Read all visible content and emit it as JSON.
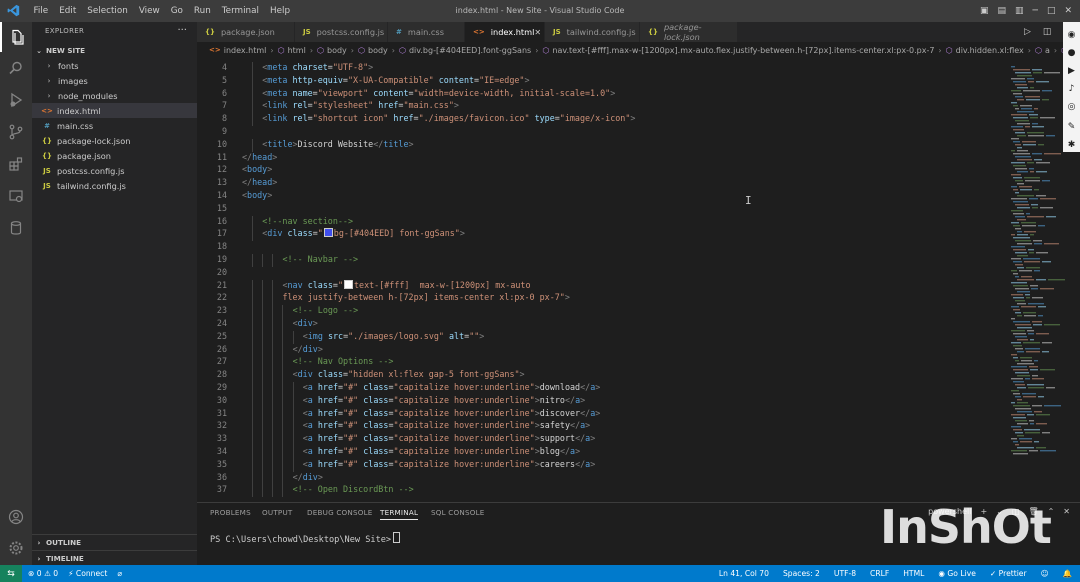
{
  "window": {
    "title": "index.html - New Site - Visual Studio Code",
    "menu": [
      "File",
      "Edit",
      "Selection",
      "View",
      "Go",
      "Run",
      "Terminal",
      "Help"
    ]
  },
  "colors": {
    "accent": "#007acc",
    "remote": "#16825d",
    "tag": "#569cd6",
    "attr": "#9cdcfe",
    "string": "#ce9178",
    "comment": "#6a9955"
  },
  "activity_icons": [
    "files-icon",
    "search-icon",
    "run-debug-icon",
    "source-control-icon",
    "extensions-icon",
    "remote-explorer-icon",
    "database-icon",
    "account-icon",
    "settings-gear-icon"
  ],
  "sidebar": {
    "header": "EXPLORER",
    "folder": "NEW SITE",
    "items": [
      {
        "label": "fonts",
        "type": "folder",
        "icon": "›"
      },
      {
        "label": "images",
        "type": "folder",
        "icon": "›"
      },
      {
        "label": "node_modules",
        "type": "folder",
        "icon": "›"
      },
      {
        "label": "index.html",
        "type": "html",
        "icon": "<>"
      },
      {
        "label": "main.css",
        "type": "css",
        "icon": "#"
      },
      {
        "label": "package-lock.json",
        "type": "json",
        "icon": "{}"
      },
      {
        "label": "package.json",
        "type": "json",
        "icon": "{}"
      },
      {
        "label": "postcss.config.js",
        "type": "js",
        "icon": "JS"
      },
      {
        "label": "tailwind.config.js",
        "type": "js",
        "icon": "JS"
      }
    ],
    "outline": "OUTLINE",
    "timeline": "TIMELINE"
  },
  "tabs": [
    {
      "label": "package.json",
      "icon": "{}"
    },
    {
      "label": "postcss.config.js",
      "icon": "JS"
    },
    {
      "label": "main.css",
      "icon": "#"
    },
    {
      "label": "index.html",
      "icon": "<>",
      "active": true
    },
    {
      "label": "tailwind.config.js",
      "icon": "JS"
    },
    {
      "label": "package-lock.json",
      "icon": "{}"
    }
  ],
  "breadcrumb": [
    "index.html",
    "html",
    "body",
    "body",
    "div.bg-[#404EED].font-ggSans",
    "nav.text-[#fff].max-w-[1200px].mx-auto.flex.justify-between.h-[72px].items-center.xl:px-0.px-7",
    "div.hidden.xl:flex",
    "a",
    "bu"
  ],
  "editor": {
    "lines": [
      {
        "n": "4",
        "indent": 2,
        "html": "<span class='pn'>&lt;</span><span class='tg'>meta</span> <span class='at'>charset</span>=<span class='st'>\"UTF-8\"</span><span class='pn'>&gt;</span>"
      },
      {
        "n": "5",
        "indent": 2,
        "html": "<span class='pn'>&lt;</span><span class='tg'>meta</span> <span class='at'>http-equiv</span>=<span class='st'>\"X-UA-Compatible\"</span> <span class='at'>content</span>=<span class='st'>\"IE=edge\"</span><span class='pn'>&gt;</span>"
      },
      {
        "n": "6",
        "indent": 2,
        "html": "<span class='pn'>&lt;</span><span class='tg'>meta</span> <span class='at'>name</span>=<span class='st'>\"viewport\"</span> <span class='at'>content</span>=<span class='st'>\"width=device-width, initial-scale=1.0\"</span><span class='pn'>&gt;</span>"
      },
      {
        "n": "7",
        "indent": 2,
        "html": "<span class='pn'>&lt;</span><span class='tg'>link</span> <span class='at'>rel</span>=<span class='st'>\"stylesheet\"</span> <span class='at'>href</span>=<span class='st'>\"main.css\"</span><span class='pn'>&gt;</span>"
      },
      {
        "n": "8",
        "indent": 2,
        "html": "<span class='pn'>&lt;</span><span class='tg'>link</span> <span class='at'>rel</span>=<span class='st'>\"shortcut icon\"</span> <span class='at'>href</span>=<span class='st'>\"./images/favicon.ico\"</span> <span class='at'>type</span>=<span class='st'>\"image/x-icon\"</span><span class='pn'>&gt;</span>"
      },
      {
        "n": "9",
        "indent": 0,
        "html": ""
      },
      {
        "n": "10",
        "indent": 2,
        "html": "<span class='pn'>&lt;</span><span class='tg'>title</span><span class='pn'>&gt;</span><span class='tx'>Discord Website</span><span class='pn'>&lt;/</span><span class='tg'>title</span><span class='pn'>&gt;</span>"
      },
      {
        "n": "11",
        "indent": 0,
        "html": "<span class='pn'>&lt;/</span><span class='tg'>head</span><span class='pn'>&gt;</span>"
      },
      {
        "n": "12",
        "indent": 0,
        "html": "<span class='pn'>&lt;</span><span class='tg'>body</span><span class='pn'>&gt;</span>"
      },
      {
        "n": "13",
        "indent": 0,
        "html": "<span class='pn'>&lt;/</span><span class='tg'>head</span><span class='pn'>&gt;</span>"
      },
      {
        "n": "14",
        "indent": 0,
        "html": "<span class='pn'>&lt;</span><span class='tg'>body</span><span class='pn'>&gt;</span>"
      },
      {
        "n": "15",
        "indent": 0,
        "html": ""
      },
      {
        "n": "16",
        "indent": 2,
        "html": "<span class='cm'>&lt;!--nav section--&gt;</span>"
      },
      {
        "n": "17",
        "indent": 2,
        "html": "<span class='pn'>&lt;</span><span class='tg'>div</span> <span class='at'>class</span>=<span class='st'>\"<span class='swatch' style='background:#404EED'></span>bg-[#404EED] font-ggSans\"</span><span class='pn'>&gt;</span>"
      },
      {
        "n": "18",
        "indent": 0,
        "html": ""
      },
      {
        "n": "19",
        "indent": 4,
        "html": "<span class='cm'>&lt;!-- Navbar --&gt;</span>"
      },
      {
        "n": "20",
        "indent": 0,
        "html": ""
      },
      {
        "n": "21",
        "indent": 4,
        "html": "<span class='pn'>&lt;</span><span class='tg'>nav</span> <span class='at'>class</span>=<span class='st'>\"<span class='swatch' style='background:#ffffff'></span>text-[#fff]  max-w-[1200px] mx-auto</span>"
      },
      {
        "n": "22",
        "indent": 4,
        "html": "<span class='st'>flex justify-between h-[72px] items-center xl:px-0 px-7\"</span><span class='pn'>&gt;</span>"
      },
      {
        "n": "23",
        "indent": 5,
        "html": "<span class='cm'>&lt;!-- Logo --&gt;</span>"
      },
      {
        "n": "24",
        "indent": 5,
        "html": "<span class='pn'>&lt;</span><span class='tg'>div</span><span class='pn'>&gt;</span>"
      },
      {
        "n": "25",
        "indent": 6,
        "html": "<span class='pn'>&lt;</span><span class='tg'>img</span> <span class='at'>src</span>=<span class='st'>\"./images/logo.svg\"</span> <span class='at'>alt</span>=<span class='st'>\"\"</span><span class='pn'>&gt;</span>"
      },
      {
        "n": "26",
        "indent": 5,
        "html": "<span class='pn'>&lt;/</span><span class='tg'>div</span><span class='pn'>&gt;</span>"
      },
      {
        "n": "27",
        "indent": 5,
        "html": "<span class='cm'>&lt;!-- Nav Options --&gt;</span>"
      },
      {
        "n": "28",
        "indent": 5,
        "html": "<span class='pn'>&lt;</span><span class='tg'>div</span> <span class='at'>class</span>=<span class='st'>\"hidden xl:flex gap-5 font-ggSans\"</span><span class='pn'>&gt;</span>"
      },
      {
        "n": "29",
        "indent": 6,
        "html": "<span class='pn'>&lt;</span><span class='tg'>a</span> <span class='at'>href</span>=<span class='st'>\"#\"</span> <span class='at'>class</span>=<span class='st'>\"capitalize hover:underline\"</span><span class='pn'>&gt;</span><span class='tx'>download</span><span class='pn'>&lt;/</span><span class='tg'>a</span><span class='pn'>&gt;</span>"
      },
      {
        "n": "30",
        "indent": 6,
        "html": "<span class='pn'>&lt;</span><span class='tg'>a</span> <span class='at'>href</span>=<span class='st'>\"#\"</span> <span class='at'>class</span>=<span class='st'>\"capitalize hover:underline\"</span><span class='pn'>&gt;</span><span class='tx'>nitro</span><span class='pn'>&lt;/</span><span class='tg'>a</span><span class='pn'>&gt;</span>"
      },
      {
        "n": "31",
        "indent": 6,
        "html": "<span class='pn'>&lt;</span><span class='tg'>a</span> <span class='at'>href</span>=<span class='st'>\"#\"</span> <span class='at'>class</span>=<span class='st'>\"capitalize hover:underline\"</span><span class='pn'>&gt;</span><span class='tx'>discover</span><span class='pn'>&lt;/</span><span class='tg'>a</span><span class='pn'>&gt;</span>"
      },
      {
        "n": "32",
        "indent": 6,
        "html": "<span class='pn'>&lt;</span><span class='tg'>a</span> <span class='at'>href</span>=<span class='st'>\"#\"</span> <span class='at'>class</span>=<span class='st'>\"capitalize hover:underline\"</span><span class='pn'>&gt;</span><span class='tx'>safety</span><span class='pn'>&lt;/</span><span class='tg'>a</span><span class='pn'>&gt;</span>"
      },
      {
        "n": "33",
        "indent": 6,
        "html": "<span class='pn'>&lt;</span><span class='tg'>a</span> <span class='at'>href</span>=<span class='st'>\"#\"</span> <span class='at'>class</span>=<span class='st'>\"capitalize hover:underline\"</span><span class='pn'>&gt;</span><span class='tx'>support</span><span class='pn'>&lt;/</span><span class='tg'>a</span><span class='pn'>&gt;</span>"
      },
      {
        "n": "34",
        "indent": 6,
        "html": "<span class='pn'>&lt;</span><span class='tg'>a</span> <span class='at'>href</span>=<span class='st'>\"#\"</span> <span class='at'>class</span>=<span class='st'>\"capitalize hover:underline\"</span><span class='pn'>&gt;</span><span class='tx'>blog</span><span class='pn'>&lt;/</span><span class='tg'>a</span><span class='pn'>&gt;</span>"
      },
      {
        "n": "35",
        "indent": 6,
        "html": "<span class='pn'>&lt;</span><span class='tg'>a</span> <span class='at'>href</span>=<span class='st'>\"#\"</span> <span class='at'>class</span>=<span class='st'>\"capitalize hover:underline\"</span><span class='pn'>&gt;</span><span class='tx'>careers</span><span class='pn'>&lt;/</span><span class='tg'>a</span><span class='pn'>&gt;</span>"
      },
      {
        "n": "36",
        "indent": 5,
        "html": "<span class='pn'>&lt;/</span><span class='tg'>div</span><span class='pn'>&gt;</span>"
      },
      {
        "n": "37",
        "indent": 5,
        "html": "<span class='cm'>&lt;!-- Open DiscordBtn --&gt;</span>"
      }
    ]
  },
  "panel": {
    "tabs": [
      "PROBLEMS",
      "OUTPUT",
      "DEBUG CONSOLE",
      "TERMINAL",
      "SQL CONSOLE"
    ],
    "active_tab": "TERMINAL",
    "terminal_prompt": "PS C:\\Users\\chowd\\Desktop\\New Site>",
    "shell": "powershell"
  },
  "status": {
    "errors": "0",
    "warnings": "0",
    "connect": "Connect",
    "position": "Ln 41, Col 70",
    "spaces": "Spaces: 2",
    "encoding": "UTF-8",
    "eol": "CRLF",
    "language": "HTML",
    "golive": "Go Live",
    "prettier": "Prettier"
  },
  "watermark": "InShOt"
}
